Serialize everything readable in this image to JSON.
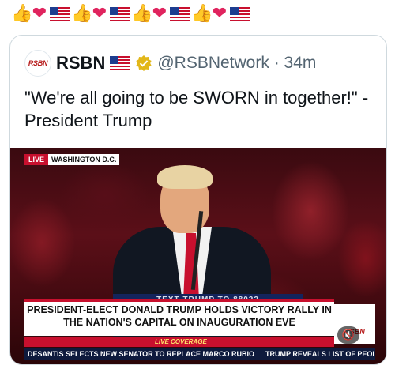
{
  "reaction_row": {
    "emojis": [
      "thumbs-up",
      "heart",
      "us-flag",
      "thumbs-up",
      "heart",
      "us-flag",
      "thumbs-up",
      "heart",
      "us-flag",
      "thumbs-up",
      "heart",
      "us-flag"
    ],
    "thumb_glyph": "👍",
    "heart_glyph": "❤"
  },
  "quote": {
    "avatar_text": "RSBN",
    "display_name": "RSBN",
    "handle_time": "@RSBNetwork · 34m",
    "text": "\"We're all going to be SWORN in together!\" - President Trump"
  },
  "video": {
    "live_label": "LIVE",
    "location": "WASHINGTON D.C.",
    "podium_sign": "TEXT TRUMP TO 88022",
    "headline": "PRESIDENT-ELECT DONALD TRUMP HOLDS VICTORY RALLY IN THE NATION'S CAPITAL ON INAUGURATION EVE",
    "live_coverage": "LIVE COVERAGE",
    "ticker_1": "DESANTIS SELECTS NEW SENATOR TO REPLACE MARCO RUBIO",
    "ticker_2": "TRUMP REVEALS LIST OF PEOI",
    "bug_text": "RSBN",
    "mute_glyph": "🔇"
  },
  "colors": {
    "verified_gold": "#e2b719",
    "live_red": "#c8102e",
    "ticker_navy": "#0e1a3d"
  }
}
